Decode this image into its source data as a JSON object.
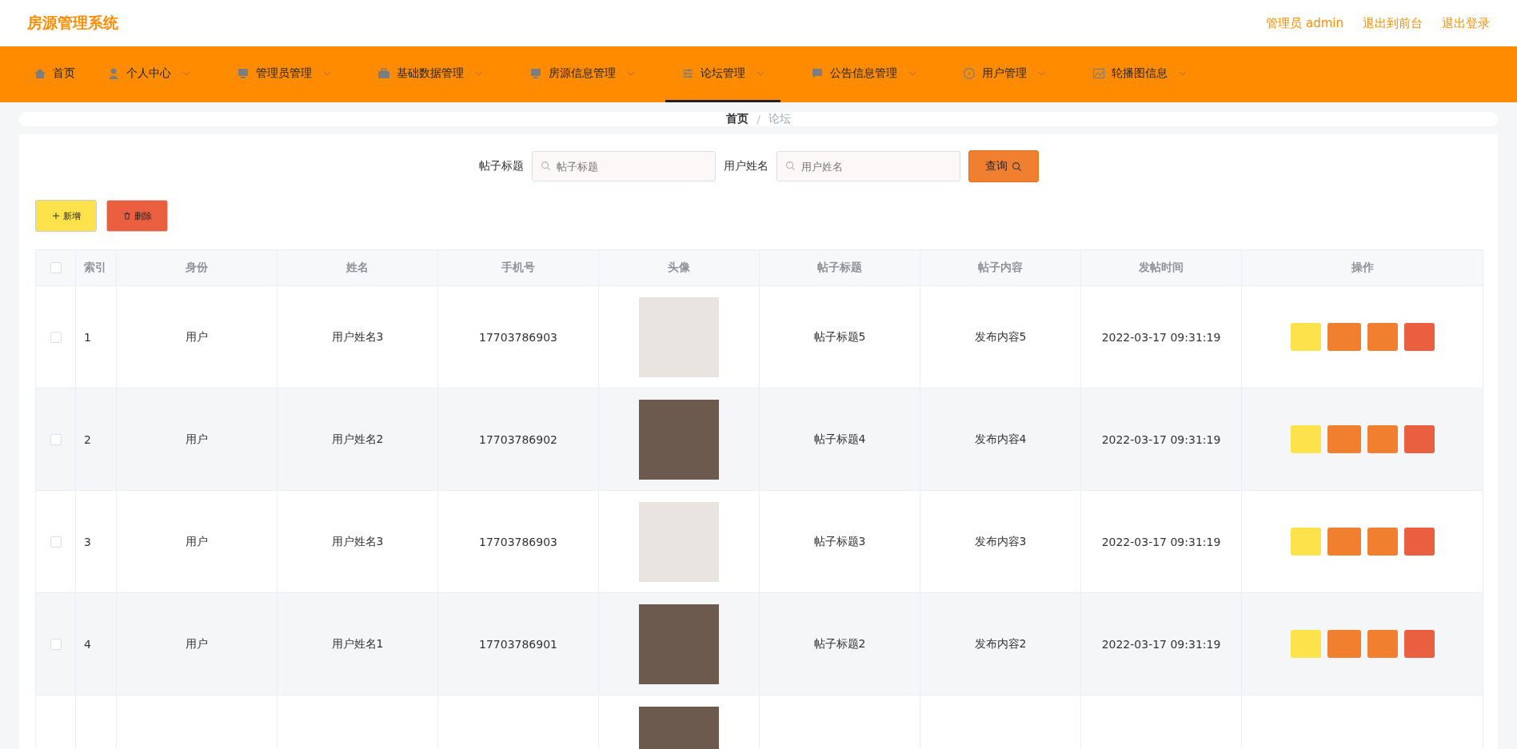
{
  "header": {
    "title": "房源管理系统",
    "links": [
      "管理员 admin",
      "退出到前台",
      "退出登录"
    ]
  },
  "nav": [
    {
      "label": "首页",
      "dropdown": false,
      "selected": false
    },
    {
      "label": "个人中心",
      "dropdown": true,
      "selected": false
    },
    {
      "label": "管理员管理",
      "dropdown": true,
      "selected": false
    },
    {
      "label": "基础数据管理",
      "dropdown": true,
      "selected": false
    },
    {
      "label": "房源信息管理",
      "dropdown": true,
      "selected": false
    },
    {
      "label": "论坛管理",
      "dropdown": true,
      "selected": true
    },
    {
      "label": "公告信息管理",
      "dropdown": true,
      "selected": false
    },
    {
      "label": "用户管理",
      "dropdown": true,
      "selected": false
    },
    {
      "label": "轮播图信息",
      "dropdown": true,
      "selected": false
    }
  ],
  "breadcrumb": [
    "首页",
    "论坛"
  ],
  "breadcrumb_separator": "/",
  "search": [
    {
      "label": "帖子标题",
      "placeholder": "帖子标题"
    },
    {
      "label": "用户姓名",
      "placeholder": "用户姓名"
    }
  ],
  "query_button": "查询",
  "toolbar": [
    {
      "label": "新增",
      "kind": "add"
    },
    {
      "label": "删除",
      "kind": "delete"
    }
  ],
  "table": {
    "header_checked": false,
    "columns": [
      "索引",
      "身份",
      "姓名",
      "手机号",
      "头像",
      "帖子标题",
      "帖子内容",
      "发帖时间",
      "操作"
    ],
    "row_actions": [
      {
        "color": "#fde24c"
      },
      {
        "color": "#f07f30"
      },
      {
        "color": "#f07f30"
      },
      {
        "color": "#ea5f40"
      }
    ],
    "rows": [
      {
        "checked": false,
        "index": "1",
        "role": "用户",
        "name": "用户姓名3",
        "phone": "17703786903",
        "avatar": {
          "kind": "illustration"
        },
        "title": "帖子标题5",
        "content": "发布内容5",
        "time": "2022-03-17 09:31:19"
      },
      {
        "checked": false,
        "index": "2",
        "role": "用户",
        "name": "用户姓名2",
        "phone": "17703786902",
        "avatar": {
          "kind": "photo"
        },
        "title": "帖子标题4",
        "content": "发布内容4",
        "time": "2022-03-17 09:31:19"
      },
      {
        "checked": false,
        "index": "3",
        "role": "用户",
        "name": "用户姓名3",
        "phone": "17703786903",
        "avatar": {
          "kind": "illustration"
        },
        "title": "帖子标题3",
        "content": "发布内容3",
        "time": "2022-03-17 09:31:19"
      },
      {
        "checked": false,
        "index": "4",
        "role": "用户",
        "name": "用户姓名1",
        "phone": "17703786901",
        "avatar": {
          "kind": "photo"
        },
        "title": "帖子标题2",
        "content": "发布内容2",
        "time": "2022-03-17 09:31:19"
      },
      {
        "avatar": {
          "kind": "photo"
        }
      }
    ]
  }
}
